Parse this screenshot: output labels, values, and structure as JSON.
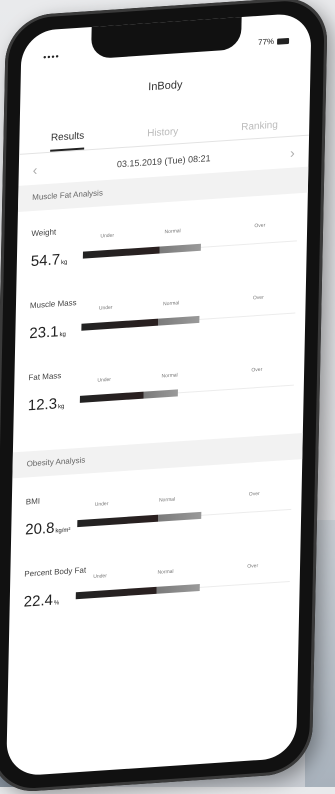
{
  "status": {
    "signal": "••••",
    "battery_text": "77%"
  },
  "app_title": "InBody",
  "tabs": [
    {
      "label": "Results",
      "active": true
    },
    {
      "label": "History",
      "active": false
    },
    {
      "label": "Ranking",
      "active": false
    }
  ],
  "date": "03.15.2019 (Tue) 08:21",
  "sections": [
    {
      "title": "Muscle Fat Analysis"
    },
    {
      "title": "Obesity Analysis"
    }
  ],
  "metrics": [
    {
      "label": "Weight",
      "value": "54.7",
      "unit": "kg",
      "fill": 0.55
    },
    {
      "label": "Muscle Mass",
      "value": "23.1",
      "unit": "kg",
      "fill": 0.55
    },
    {
      "label": "Fat Mass",
      "value": "12.3",
      "unit": "kg",
      "fill": 0.46
    },
    {
      "label": "BMI",
      "value": "20.8",
      "unit": "kg/m²",
      "fill": 0.58
    },
    {
      "label": "Percent Body Fat",
      "value": "22.4",
      "unit": "%",
      "fill": 0.58
    }
  ],
  "scale_labels": {
    "under": "Under",
    "normal": "Normal",
    "over": "Over"
  }
}
